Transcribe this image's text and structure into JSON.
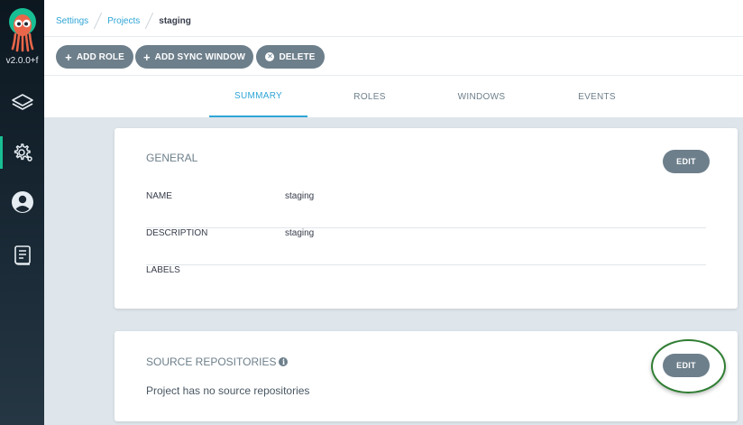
{
  "app": {
    "version": "v2.0.0+f"
  },
  "sidebar": {
    "items": [
      {
        "icon": "layers-icon"
      },
      {
        "icon": "gear-icon",
        "active": true
      },
      {
        "icon": "user-icon"
      },
      {
        "icon": "docs-icon"
      }
    ]
  },
  "breadcrumb": {
    "items": [
      "Settings",
      "Projects",
      "staging"
    ]
  },
  "toolbar": {
    "add_role": "ADD ROLE",
    "add_sync_window": "ADD SYNC WINDOW",
    "delete": "DELETE"
  },
  "tabs": [
    {
      "label": "SUMMARY",
      "active": true
    },
    {
      "label": "ROLES"
    },
    {
      "label": "WINDOWS"
    },
    {
      "label": "EVENTS"
    }
  ],
  "general": {
    "title": "GENERAL",
    "edit_label": "EDIT",
    "rows": [
      {
        "label": "NAME",
        "value": "staging"
      },
      {
        "label": "DESCRIPTION",
        "value": "staging"
      },
      {
        "label": "LABELS",
        "value": ""
      }
    ]
  },
  "source_repositories": {
    "title": "SOURCE REPOSITORIES",
    "edit_label": "EDIT",
    "empty_text": "Project has no source repositories"
  },
  "colors": {
    "accent": "#2ea5d6",
    "button": "#6d7f8b",
    "active_nav": "#18be94",
    "highlight": "#2f7d32"
  }
}
